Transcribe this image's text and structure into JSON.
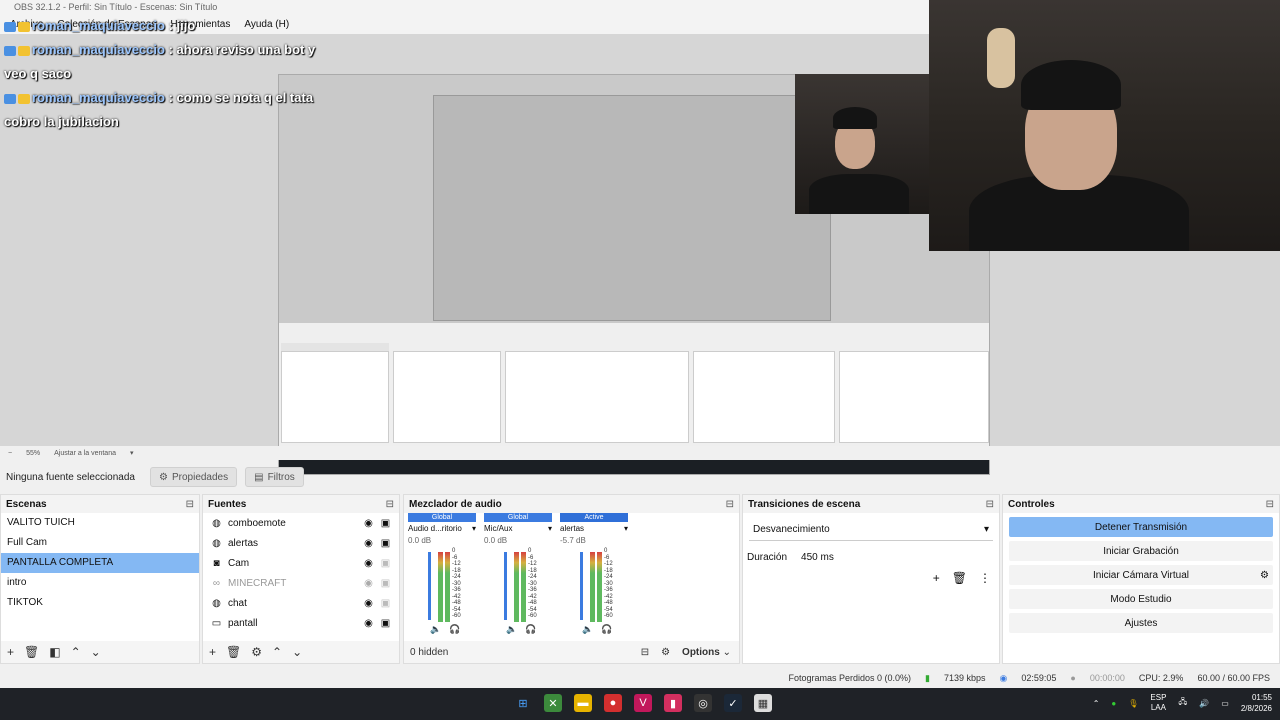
{
  "window": {
    "title": "OBS 32.1.2 - Perfil: Sin Título - Escenas: Sin Título"
  },
  "menu": [
    "Archivo",
    "Colección de Escenas",
    "Herramientas",
    "Ayuda (H)"
  ],
  "chat": [
    {
      "user": "roman_maquiaveccio",
      "text": ": jijo"
    },
    {
      "user": "roman_maquiaveccio",
      "text": ": ahora reviso una bot y veo q saco"
    },
    {
      "user": "roman_maquiaveccio",
      "text": ": como se nota q el tata cobro la jubilacion"
    }
  ],
  "zoom": {
    "level": "55%",
    "fit": "Ajustar a la ventana"
  },
  "properties_bar": {
    "none_selected": "Ninguna fuente seleccionada",
    "properties": "Propiedades",
    "filters": "Filtros"
  },
  "scenes": {
    "title": "Escenas",
    "items": [
      "VALITO TUICH",
      "Full Cam",
      "PANTALLA COMPLETA",
      "intro",
      "TIKTOK"
    ],
    "selected_index": 2
  },
  "sources": {
    "title": "Fuentes",
    "items": [
      {
        "name": "comboemote",
        "icon": "globe-icon",
        "visible": true,
        "locked": true
      },
      {
        "name": "alertas",
        "icon": "globe-icon",
        "visible": true,
        "locked": true
      },
      {
        "name": "Cam",
        "icon": "camera-icon",
        "visible": true,
        "locked": false
      },
      {
        "name": "MINECRAFT",
        "icon": "link-icon",
        "visible": false,
        "locked": false
      },
      {
        "name": "chat",
        "icon": "globe-icon",
        "visible": true,
        "locked": false
      },
      {
        "name": "pantall",
        "icon": "monitor-icon",
        "visible": true,
        "locked": true
      }
    ]
  },
  "mixer": {
    "title": "Mezclador de audio",
    "channels": [
      {
        "tag": "Global",
        "name": "Audio d...ritorio",
        "db": "0.0 dB"
      },
      {
        "tag": "Global",
        "name": "Mic/Aux",
        "db": "0.0 dB"
      },
      {
        "tag": "Active",
        "name": "alertas",
        "db": "-5.7 dB"
      }
    ],
    "scale": [
      "0",
      "-6",
      "-12",
      "-18",
      "-24",
      "-30",
      "-36",
      "-42",
      "-48",
      "-54",
      "-60"
    ],
    "hidden": "0 hidden",
    "options": "Options"
  },
  "transitions": {
    "title": "Transiciones de escena",
    "current": "Desvanecimiento",
    "duration_label": "Duración",
    "duration_value": "450 ms"
  },
  "controls": {
    "title": "Controles",
    "stop_stream": "Detener Transmisión",
    "start_recording": "Iniciar Grabación",
    "virtual_cam": "Iniciar Cámara Virtual",
    "studio_mode": "Modo Estudio",
    "settings": "Ajustes"
  },
  "status": {
    "dropped": "Fotogramas Perdidos 0 (0.0%)",
    "bitrate": "7139 kbps",
    "stream_time": "02:59:05",
    "rec_time": "00:00:00",
    "cpu": "CPU: 2.9%",
    "fps": "60.00 / 60.00 FPS"
  },
  "tray": {
    "lang1": "ESP",
    "lang2": "LAA",
    "time": "01:55",
    "date": "2/8/2026"
  },
  "colors": {
    "accent": "#84b8f3",
    "taskbar": "#1f2227"
  }
}
